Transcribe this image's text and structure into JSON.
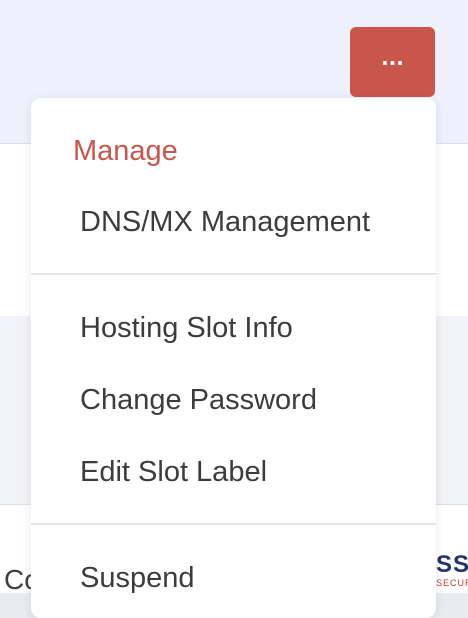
{
  "page": {
    "background_text": "Co",
    "brand": {
      "main": "SS",
      "sub": "SECURE"
    }
  },
  "header": {
    "more_button_label": "...",
    "more_button_color": "#c9564a"
  },
  "menu": {
    "header_label": "Manage",
    "header_color": "#c9564a",
    "items": [
      {
        "label": "DNS/MX Management"
      },
      {
        "label": "Hosting Slot Info"
      },
      {
        "label": "Change Password"
      },
      {
        "label": "Edit Slot Label"
      },
      {
        "label": "Suspend"
      }
    ]
  }
}
